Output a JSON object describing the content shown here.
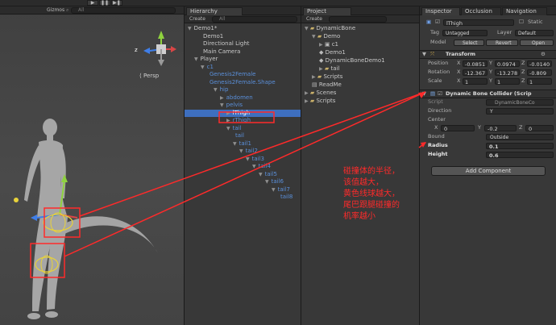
{
  "colors": {
    "accent": "#3e6fbf",
    "annotation": "#ff2a2a",
    "prefab_blue": "#5a8fd9",
    "gizmo_yellow": "#e8d23a"
  },
  "scene": {
    "gizmos_label": "Gizmos",
    "search_placeholder": "All",
    "persp_label": "Persp",
    "axis_z": "z"
  },
  "hierarchy": {
    "tab": "Hierarchy",
    "create": "Create",
    "search_placeholder": "All",
    "items": [
      {
        "label": "Demo1*",
        "tri": "▼"
      },
      {
        "label": "Demo1",
        "tri": ""
      },
      {
        "label": "Directional Light",
        "tri": ""
      },
      {
        "label": "Main Camera",
        "tri": ""
      },
      {
        "label": "Player",
        "tri": "▼"
      },
      {
        "label": "c1",
        "tri": "▼"
      },
      {
        "label": "Genesis2Female",
        "tri": ""
      },
      {
        "label": "Genesis2Female.Shape",
        "tri": ""
      },
      {
        "label": "hip",
        "tri": "▼"
      },
      {
        "label": "abdomen",
        "tri": "▶"
      },
      {
        "label": "pelvis",
        "tri": "▼"
      },
      {
        "label": "lThigh",
        "tri": "▶"
      },
      {
        "label": "rThigh",
        "tri": "▶"
      },
      {
        "label": "tail",
        "tri": "▼"
      },
      {
        "label": "tail",
        "tri": ""
      },
      {
        "label": "tail1",
        "tri": "▼"
      },
      {
        "label": "tail2",
        "tri": "▼"
      },
      {
        "label": "tail3",
        "tri": "▼"
      },
      {
        "label": "tail4",
        "tri": "▼"
      },
      {
        "label": "tail5",
        "tri": "▼"
      },
      {
        "label": "tail6",
        "tri": "▼"
      },
      {
        "label": "tail7",
        "tri": "▼"
      },
      {
        "label": "tail8",
        "tri": ""
      }
    ]
  },
  "project": {
    "tab": "Project",
    "create": "Create",
    "items": [
      {
        "label": "DynamicBone",
        "tri": "▼"
      },
      {
        "label": "Demo",
        "tri": "▼"
      },
      {
        "label": "c1",
        "tri": "▶"
      },
      {
        "label": "Demo1",
        "tri": ""
      },
      {
        "label": "DynamicBoneDemo1",
        "tri": ""
      },
      {
        "label": "tail",
        "tri": "▶"
      },
      {
        "label": "Scripts",
        "tri": "▶"
      },
      {
        "label": "ReadMe",
        "tri": ""
      },
      {
        "label": "Scenes",
        "tri": "▶"
      },
      {
        "label": "Scripts",
        "tri": "▶"
      }
    ]
  },
  "inspector": {
    "tabs": [
      "Inspector",
      "Occlusion",
      "Navigation"
    ],
    "object_name": "lThigh",
    "static_label": "Static",
    "tag_label": "Tag",
    "tag_value": "Untagged",
    "layer_label": "Layer",
    "layer_value": "Default",
    "model_label": "Model",
    "select": "Select",
    "revert": "Revert",
    "open": "Open",
    "transform": {
      "title": "Transform",
      "position_label": "Position",
      "pos_x": "-0.0851",
      "pos_y": "0.0974",
      "pos_z": "-0.0140",
      "rotation_label": "Rotation",
      "rot_x": "-12.367",
      "rot_y": "-13.278",
      "rot_z": "-0.809",
      "scale_label": "Scale",
      "sc_x": "1",
      "sc_y": "1",
      "sc_z": "1"
    },
    "collider": {
      "title": "Dynamic Bone Collider (Scrip",
      "script_label": "Script",
      "script_value": "DynamicBoneCo",
      "direction_label": "Direction",
      "direction_value": "Y",
      "center_label": "Center",
      "cx": "0",
      "cy": "-0.2",
      "cz": "0",
      "bound_label": "Bound",
      "bound_value": "Outside",
      "radius_label": "Radius",
      "radius_value": "0.1",
      "height_label": "Height",
      "height_value": "0.6"
    },
    "add_component": "Add Component",
    "axis_x": "X",
    "axis_y": "Y",
    "axis_z": "Z"
  },
  "annotation": {
    "lines": [
      "碰撞体的半径，",
      "该值越大，",
      "黄色线球越大，",
      "尾巴跟腿碰撞的",
      "机率越小"
    ]
  }
}
